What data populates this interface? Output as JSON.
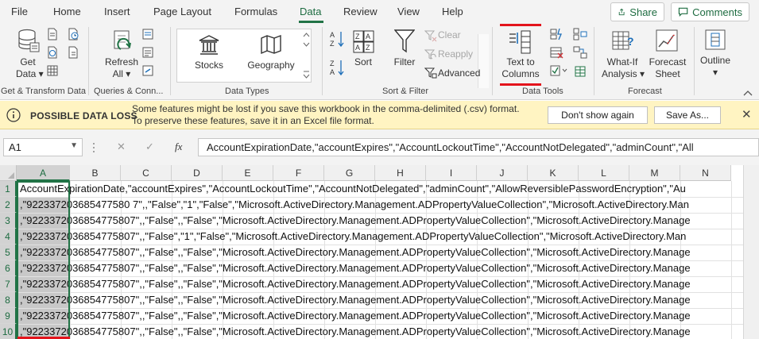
{
  "tabs": [
    {
      "label": "File",
      "active": false
    },
    {
      "label": "Home",
      "active": false
    },
    {
      "label": "Insert",
      "active": false
    },
    {
      "label": "Page Layout",
      "active": false
    },
    {
      "label": "Formulas",
      "active": false
    },
    {
      "label": "Data",
      "active": true
    },
    {
      "label": "Review",
      "active": false
    },
    {
      "label": "View",
      "active": false
    },
    {
      "label": "Help",
      "active": false
    }
  ],
  "top_buttons": {
    "share": "Share",
    "comments": "Comments"
  },
  "ribbon": {
    "get_data": {
      "line1": "Get",
      "line2": "Data ▾"
    },
    "refresh_all": {
      "line1": "Refresh",
      "line2": "All ▾"
    },
    "stocks": "Stocks",
    "geography": "Geography",
    "sort": "Sort",
    "filter": "Filter",
    "clear": "Clear",
    "reapply": "Reapply",
    "advanced": "Advanced",
    "text_to_columns": {
      "line1": "Text to",
      "line2": "Columns"
    },
    "what_if": {
      "line1": "What-If",
      "line2": "Analysis ▾"
    },
    "forecast_sheet": {
      "line1": "Forecast",
      "line2": "Sheet"
    },
    "outline": {
      "line1": "Outline",
      "line2": "▾"
    },
    "groups": {
      "get_transform": "Get & Transform Data",
      "queries": "Queries & Conn...",
      "data_types": "Data Types",
      "sort_filter": "Sort & Filter",
      "data_tools": "Data Tools",
      "forecast": "Forecast"
    }
  },
  "message_bar": {
    "title": "POSSIBLE DATA LOSS",
    "line1": "Some features might be lost if you save this workbook in the comma-delimited (.csv) format.",
    "line2": "To preserve these features, save it in an Excel file format.",
    "dont_show": "Don't show again",
    "save_as": "Save As..."
  },
  "formula_bar": {
    "name_box": "A1",
    "cancel": "✕",
    "enter": "✓",
    "fx": "fx",
    "formula": "AccountExpirationDate,\"accountExpires\",\"AccountLockoutTime\",\"AccountNotDelegated\",\"adminCount\",\"All"
  },
  "grid": {
    "columns": [
      "A",
      "B",
      "C",
      "D",
      "E",
      "F",
      "G",
      "H",
      "I",
      "J",
      "K",
      "L",
      "M",
      "N"
    ],
    "rows": [
      "1",
      "2",
      "3",
      "4",
      "5",
      "6",
      "7",
      "8",
      "9",
      "10"
    ],
    "cells": [
      "AccountExpirationDate,\"accountExpires\",\"AccountLockoutTime\",\"AccountNotDelegated\",\"adminCount\",\"AllowReversiblePasswordEncryption\",\"Au",
      ",\"922337203685477580 7\",,\"False\",\"1\",\"False\",\"Microsoft.ActiveDirectory.Management.ADPropertyValueCollection\",\"Microsoft.ActiveDirectory.Man",
      ",\"9223372036854775807\",,\"False\",,\"False\",\"Microsoft.ActiveDirectory.Management.ADPropertyValueCollection\",\"Microsoft.ActiveDirectory.Manage",
      ",\"9223372036854775807\",,\"False\",\"1\",\"False\",\"Microsoft.ActiveDirectory.Management.ADPropertyValueCollection\",\"Microsoft.ActiveDirectory.Man",
      ",\"9223372036854775807\",,\"False\",,\"False\",\"Microsoft.ActiveDirectory.Management.ADPropertyValueCollection\",\"Microsoft.ActiveDirectory.Manage",
      ",\"9223372036854775807\",,\"False\",,\"False\",\"Microsoft.ActiveDirectory.Management.ADPropertyValueCollection\",\"Microsoft.ActiveDirectory.Manage",
      ",\"9223372036854775807\",,\"False\",,\"False\",\"Microsoft.ActiveDirectory.Management.ADPropertyValueCollection\",\"Microsoft.ActiveDirectory.Manage",
      ",\"9223372036854775807\",,\"False\",,\"False\",\"Microsoft.ActiveDirectory.Management.ADPropertyValueCollection\",\"Microsoft.ActiveDirectory.Manage",
      ",\"9223372036854775807\",,\"False\",,\"False\",\"Microsoft.ActiveDirectory.Management.ADPropertyValueCollection\",\"Microsoft.ActiveDirectory.Manage",
      ",\"9223372036854775807\",,\"False\",,\"False\",\"Microsoft.ActiveDirectory.Management.ADPropertyValueCollection\",\"Microsoft.ActiveDirectory.Manage"
    ]
  },
  "colors": {
    "accent": "#217346",
    "highlight": "#e3141c",
    "message_bg": "#fff4c2"
  }
}
